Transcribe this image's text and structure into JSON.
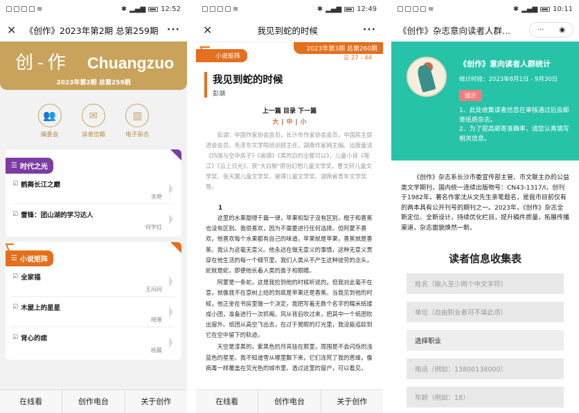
{
  "phone1": {
    "status": {
      "time": "12:52",
      "signal": "4G"
    },
    "nav": {
      "title": "《创作》2023年第2期 总第259期"
    },
    "banner": {
      "logo_cn": "创-作",
      "logo_en": "Chuangzuo",
      "issue": "2023年第2期 总第259期"
    },
    "quick": [
      {
        "icon": "people-icon",
        "glyph": "👥",
        "label": "编委会"
      },
      {
        "icon": "letter-icon",
        "glyph": "✉",
        "label": "读者信箱"
      },
      {
        "icon": "books-icon",
        "glyph": "▥",
        "label": "电子杂志"
      }
    ],
    "section1": {
      "tag": "时代之光",
      "items": [
        {
          "title": "鹤舞长江之巅",
          "author": "余艳"
        },
        {
          "title": "雷锋：团山湖的学习达人",
          "author": "何宇红"
        }
      ]
    },
    "section2": {
      "tag": "小说矩阵",
      "items": [
        {
          "title": "全家福",
          "author": "王闷闷"
        },
        {
          "title": "木屋上的星星",
          "author": "晓寒"
        },
        {
          "title": "背心的痣",
          "author": "杨晨"
        }
      ]
    },
    "tabs": [
      "在线看",
      "创作电台",
      "关于创作"
    ]
  },
  "phone2": {
    "status": {
      "time": "12:49"
    },
    "nav": {
      "title": "我见到蛇的时候"
    },
    "head": {
      "section": "小说矩阵",
      "issue": "2023年第3期 总第260期",
      "pages": "27 - 44"
    },
    "article": {
      "title": "我见到蛇的时候",
      "author": "彭湖",
      "nav": "上一篇 目录 下一篇",
      "sizes": [
        "大",
        "中",
        "小"
      ],
      "bio": "彭湖：中国作家协会会员，长沙市作家协会会员，中国民主促进会会员。毛泽东文学院培训部主任，湖南作家网主编。出版童话《玛丽与空中房子》《画镇》《黑的白的全都可以》，儿童小说《噬江》《云上日光》。获\"大白鲸\"原创幻想儿童文学奖、曹文轩儿童文学奖、张天翼儿童文学奖、谢璞儿童文学奖、湖南省青年文学奖等。",
      "section_num": "1",
      "paragraphs": [
        "这里的水果甜得千篇一律，苹果和梨子没有区别，橙子和香蕉也没有区别。我很喜欢，因为不需要进行任何选择。但阿蒙不喜欢，他喜欢每个水果都有自己的味道，苹果就是苹果，香蕉就是香蕉。我认为这毫无意义。他永远在做无意义的事情，这种无意义贯穿在他生活的每一个细节里。我们人类从不产生这种徒劳的念头，蛇就是蛇，即便他长着人类的鼻子和眼睛。",
        "阿蒙是一条蛇，这是我捡到他的时候听说的，但我对此毫不在意，就像我不在意树上结的到底是苹果还是香蕉。当我见到他的时候，他正坐在书房里做一个决定，我把写着无数个名字的糯米纸揉成小团，准备进行一次抓阄。风从背后吹过来，把其中一个纸团吹出窗外。纸团从高空飞出去，在过于晃眼的灯光里，我没能追踪到它在空中留下的轨迹。",
        "天空是漆黑的，紫黑色的月亮挂在那里，周围是不会闪烁的浅蓝色的星星。我不知道雪从哪里飘下来，它们冻死了我的思维，像病毒一样覆盖在荧光色的城市里。透过这里的窗户，可以看见，"
      ]
    },
    "tabs": [
      "在线看",
      "创作电台",
      "关于创作"
    ]
  },
  "phone3": {
    "status": {
      "time": "10:11"
    },
    "nav": {
      "title": "《创作》杂志意向读者人群..."
    },
    "stat": {
      "title": "《创作》意向读者人群统计",
      "time": "统计时段：2023年8月1日 - 9月30日",
      "hint": "提示",
      "notes": [
        "1、此处收集读者信息在审核通过后会邮寄纸质杂志。",
        "2、为了提高邮寄准确率，请您认真填写相关信息。"
      ]
    },
    "intro": "《创作》杂志系长沙市委宣传部主管、市文联主办的公益类文学期刊，国内统一连续出版物号：CN43-1317/I，创刊于1982年，著名作家沈从文先生亲笔题名，是我市目前仅有的两本具有公开刊号的期刊之一。2023年，《创作》杂志全新定位、全新设计，持续优化栏目，提升稿件质量，拓展传播渠道，杂志面貌焕然一新。",
    "form": {
      "title": "读者信息收集表",
      "fields": [
        {
          "placeholder": "姓名（输入至少两个中文字符）"
        },
        {
          "placeholder": "单位（自由职业者可不填此项）"
        },
        {
          "value": "选择职业"
        },
        {
          "placeholder": "电话（例如：13800138000）"
        },
        {
          "placeholder": "年龄（例如：18）"
        }
      ]
    }
  }
}
